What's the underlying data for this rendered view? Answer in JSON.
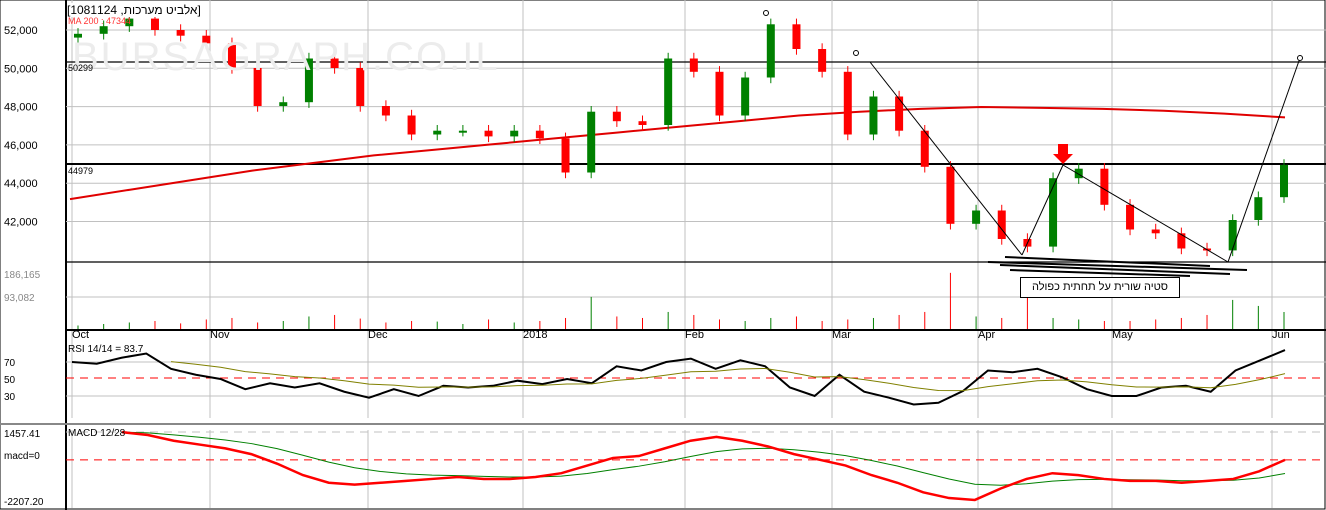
{
  "header": {
    "title": "[1081124 ,אלביט מערכות]",
    "ma_label": "MA 200 : 47344",
    "watermark": "BURSAGRAPH.CO.IL"
  },
  "annotation": {
    "text": "סטיה שורית על תחתית כפולה"
  },
  "colors": {
    "up": "#008000",
    "down": "#ff0000",
    "ma": "#e00000",
    "rsi_signal": "#808000"
  },
  "chart_data": [
    {
      "type": "candlestick",
      "title": "[1081124 ,אלביט מערכות]",
      "y_ticks": [
        "52,000",
        "50,000",
        "48,000",
        "46,000",
        "44,000",
        "42,000"
      ],
      "ylim": [
        40000,
        53500
      ],
      "level_lines": [
        {
          "label": "50299",
          "value": 50299
        },
        {
          "label": "44979",
          "value": 44979
        }
      ],
      "x_ticks": [
        "Oct",
        "Nov",
        "Dec",
        "2018",
        "Feb",
        "Mar",
        "Apr",
        "May",
        "Jun"
      ],
      "close": [
        51800,
        52200,
        52600,
        52000,
        51700,
        51300,
        50000,
        48000,
        48200,
        50500,
        50000,
        48000,
        47500,
        46500,
        46700,
        46700,
        46400,
        46700,
        46300,
        44500,
        47700,
        47200,
        47000,
        50500,
        49800,
        47500,
        49500,
        52300,
        51000,
        49800,
        46500,
        48500,
        46700,
        44800,
        41800,
        42500,
        41000,
        40600,
        44200,
        44700,
        42800,
        41500,
        41300,
        40500,
        40400,
        42000,
        43200,
        44900
      ],
      "ma200": [
        43100,
        43600,
        44100,
        44600,
        45000,
        45400,
        45700,
        46000,
        46300,
        46600,
        46900,
        47200,
        47500,
        47700,
        47850,
        47950,
        47900,
        47850,
        47750,
        47600,
        47400
      ]
    },
    {
      "type": "bar",
      "title": "Volume",
      "y_ticks": [
        "186,165",
        "93,082"
      ],
      "ylim": [
        0,
        230000
      ],
      "values": [
        15000,
        20000,
        25000,
        30000,
        22000,
        35000,
        40000,
        25000,
        30000,
        45000,
        50000,
        38000,
        25000,
        30000,
        28000,
        20000,
        35000,
        25000,
        30000,
        40000,
        110000,
        45000,
        40000,
        60000,
        50000,
        35000,
        30000,
        40000,
        45000,
        30000,
        35000,
        40000,
        50000,
        60000,
        190000,
        45000,
        40000,
        150000,
        40000,
        35000,
        30000,
        30000,
        35000,
        40000,
        50000,
        100000,
        80000,
        60000
      ]
    },
    {
      "type": "line",
      "title": "RSI 14/14 = 83.7",
      "y_ticks": [
        "70",
        "50",
        "30"
      ],
      "ylim": [
        10,
        95
      ],
      "reference": 50,
      "values": [
        70,
        68,
        75,
        80,
        62,
        55,
        50,
        38,
        45,
        40,
        45,
        35,
        28,
        38,
        30,
        42,
        40,
        42,
        48,
        44,
        50,
        45,
        65,
        60,
        70,
        74,
        62,
        72,
        65,
        40,
        30,
        55,
        35,
        28,
        20,
        22,
        36,
        60,
        58,
        62,
        52,
        38,
        30,
        30,
        40,
        42,
        35,
        60,
        72,
        84
      ]
    },
    {
      "type": "line",
      "title": "MACD 12/28",
      "y_ticks": [
        "1457.41",
        "macd=0",
        "-2207.20"
      ],
      "ylim": [
        -2207.2,
        1457.41
      ],
      "values": [
        1450,
        1300,
        1000,
        800,
        600,
        300,
        -200,
        -800,
        -1200,
        -1300,
        -1200,
        -1100,
        -1000,
        -900,
        -1000,
        -1000,
        -900,
        -700,
        -300,
        100,
        200,
        600,
        1000,
        1200,
        1000,
        700,
        300,
        0,
        -300,
        -800,
        -1200,
        -1700,
        -2000,
        -2100,
        -1500,
        -1000,
        -700,
        -800,
        -1000,
        -1100,
        -1100,
        -1200,
        -1100,
        -1000,
        -600,
        0
      ]
    }
  ]
}
